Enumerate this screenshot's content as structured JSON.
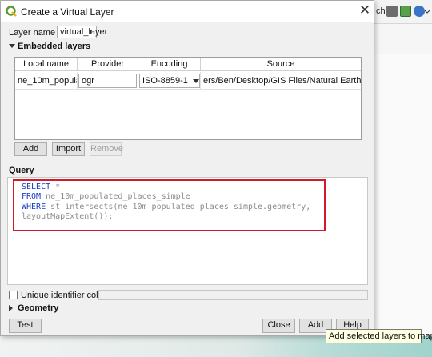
{
  "window": {
    "title": "Create a Virtual Layer"
  },
  "layer_name": {
    "label": "Layer name",
    "value": "virtual_layer"
  },
  "embedded": {
    "section_title": "Embedded layers",
    "columns": [
      "Local name",
      "Provider",
      "Encoding",
      "Source"
    ],
    "rows": [
      {
        "local_name": "ne_10m_popula...",
        "provider": "ogr",
        "encoding": "ISO-8859-1",
        "source": "ers/Ben/Desktop/GIS Files/Natural Earth ..."
      }
    ],
    "buttons": {
      "add": "Add",
      "import": "Import",
      "remove": "Remove"
    }
  },
  "query": {
    "label": "Query",
    "lines": [
      {
        "kw": "SELECT",
        "rest": " *"
      },
      {
        "kw": "FROM",
        "rest": " ne_10m_populated_places_simple"
      },
      {
        "kw": "WHERE",
        "rest": " st_intersects(ne_10m_populated_places_simple.geometry,"
      },
      {
        "kw": "",
        "rest": "layoutMapExtent());"
      }
    ]
  },
  "unique_id": {
    "label": "Unique identifier column",
    "value": ""
  },
  "geometry": {
    "label": "Geometry"
  },
  "footer": {
    "test": "Test",
    "close": "Close",
    "add": "Add",
    "help": "Help"
  },
  "tooltip": {
    "text": "Add selected layers to map"
  },
  "background": {
    "toolbar_text": "ch"
  },
  "colors": {
    "highlight_frame": "#d21a2a",
    "keyword": "#1c3fbf"
  }
}
